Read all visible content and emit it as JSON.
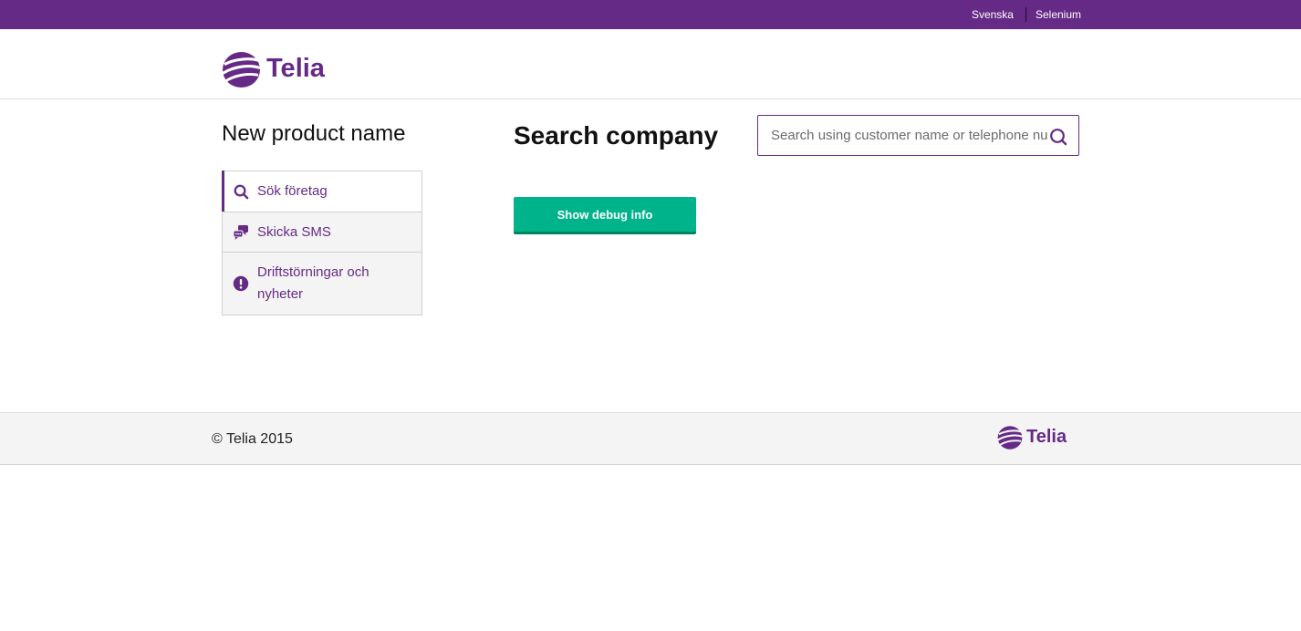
{
  "topbar": {
    "links": [
      "Svenska",
      "Selenium"
    ]
  },
  "brand": {
    "name": "Telia",
    "color": "#652a86",
    "icon": "telia-pebble-logo"
  },
  "sidebar": {
    "title": "New product name",
    "items": [
      {
        "label": "Sök företag",
        "icon": "search-icon",
        "active": true
      },
      {
        "label": "Skicka SMS",
        "icon": "sms-chat-icon",
        "active": false
      },
      {
        "label": "Driftstörningar och nyheter",
        "icon": "alert-icon",
        "active": false
      }
    ]
  },
  "main": {
    "title": "Search company",
    "search": {
      "placeholder": "Search using customer name or telephone number",
      "value": ""
    },
    "debug_button_label": "Show debug info",
    "accent": "#00b38a"
  },
  "footer": {
    "copyright": "© Telia 2015",
    "logo_text": "Telia"
  }
}
